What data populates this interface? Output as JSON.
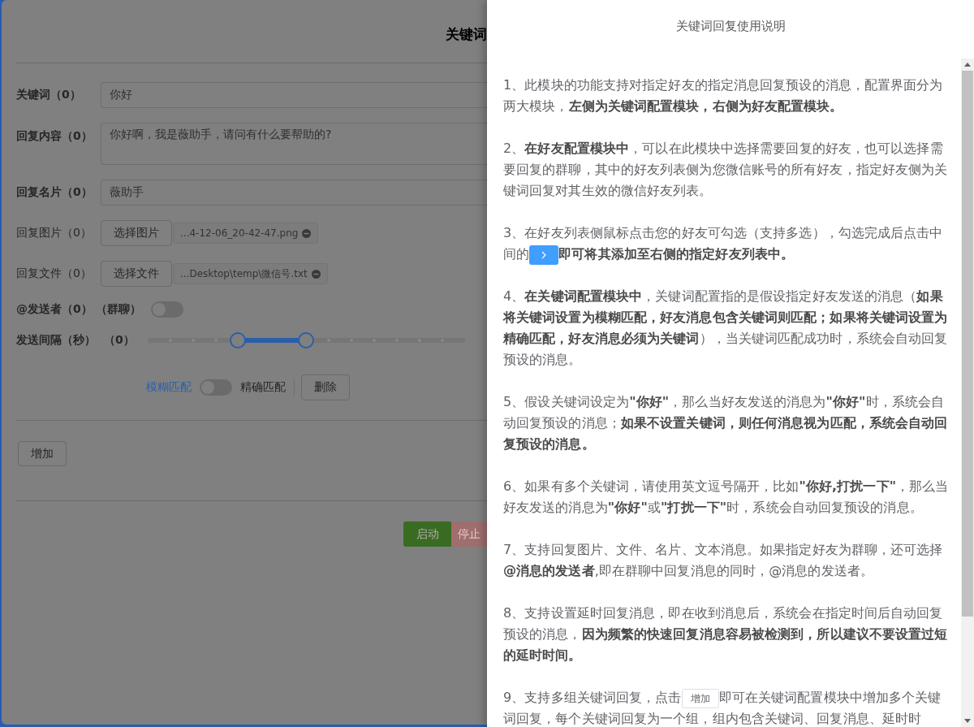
{
  "left_page": {
    "title": "关键词",
    "fields": [
      {
        "kind": "input",
        "label": "关键词（0）",
        "value": "你好"
      },
      {
        "kind": "textarea",
        "label": "回复内容（0）",
        "value": "你好啊，我是薇助手，请问有什么要帮助的?"
      },
      {
        "kind": "input",
        "label": "回复名片（0）",
        "value": "薇助手"
      },
      {
        "kind": "file",
        "label": "回复图片（0）",
        "button": "选择图片",
        "file": "...4-12-06_20-42-47.png"
      },
      {
        "kind": "file",
        "label": "回复文件（0）",
        "button": "选择文件",
        "file": "...Desktop\\temp\\微信号.txt"
      },
      {
        "kind": "toggle",
        "label": "@发送者（0）",
        "note": "（群聊）",
        "on": false
      },
      {
        "kind": "slider",
        "label": "发送间隔（秒）",
        "note": "（0）",
        "thumbs": [
          {
            "level": 0.285
          },
          {
            "level": 0.5
          }
        ]
      }
    ],
    "match": {
      "options": [
        {
          "label": "模糊匹配",
          "selected": true
        },
        {
          "label": "精确匹配",
          "selected": false
        }
      ],
      "delete_button": "删除"
    },
    "add_button": "增加",
    "start_button": "启动",
    "stop_button": "停止"
  },
  "drawer": {
    "title": "关键词回复使用说明",
    "paragraphs": [
      [
        {
          "kind": "text",
          "text": "1、此模块的功能支持对指定好友的指定消息回复预设的消息，配置界面分为两大模块，**左侧为关键词配置模块，右侧为好友配置模块。**"
        }
      ],
      [
        {
          "kind": "text",
          "text": "2、**在好友配置模块中**，可以在此模块中选择需要回复的好友，也可以选择需要回复的群聊，其中的好友列表侧为您微信账号的所有好友，指定好友侧为关键词回复对其生效的微信好友列表。"
        }
      ],
      [
        {
          "kind": "text",
          "text": "3、在好友列表侧鼠标点击您的好友可勾选（支持多选），勾选完成后点击中"
        },
        {
          "kind": "text",
          "text": "间的"
        },
        {
          "kind": "chevron-button"
        },
        {
          "kind": "text",
          "text": "**即可将其添加至右侧的指定好友列表中。**"
        }
      ],
      [
        {
          "kind": "text",
          "text": "4、**在关键词配置模块中**，关键词配置指的是假设指定好友发送的消息（**如果将关键词设置为模糊匹配，好友消息包含关键词则匹配；如果将关键词设置为精确匹配，好友消息必须为关键词**），当关键词匹配成功时，系统会自动回复预设的消息。"
        }
      ],
      [
        {
          "kind": "text",
          "text": "5、假设关键词设定为**\"你好\"**，那么当好友发送的消息为**\"你好\"**时，系统会自动回复预设的消息；**如果不设置关键词，则任何消息视为匹配，系统会自动回复预设的消息。**"
        }
      ],
      [
        {
          "kind": "text",
          "text": "6、如果有多个关键词，请使用英文逗号隔开，比如**\"你好,打扰一下\"**，那么当好友发送的消息为**\"你好\"**或**\"打扰一下\"**时，系统会自动回复预设的消息。"
        }
      ],
      [
        {
          "kind": "text",
          "text": "7、支持回复图片、文件、名片、文本消息。如果指定好友为群聊，还可选择**@消息的发送者**,即在群聊中回复消息的同时，@消息的发送者。"
        }
      ],
      [
        {
          "kind": "text",
          "text": "8、支持设置延时回复消息，即在收到消息后，系统会在指定时间后自动回复预设的消息，**因为频繁的快速回复消息容易被检测到，所以建议不要设置过短的延时时间。**"
        }
      ],
      [
        {
          "kind": "text",
          "text": "9、支持多组关键词回复，点击"
        },
        {
          "kind": "button",
          "text": "增加"
        },
        {
          "kind": "text",
          "text": "即可在关键词配置模块中增加多个关键"
        },
        {
          "kind": "text",
          "text": "词回复，每个关键词回复为一个组，组内包含关键词、回复消息、延时时"
        }
      ]
    ]
  }
}
